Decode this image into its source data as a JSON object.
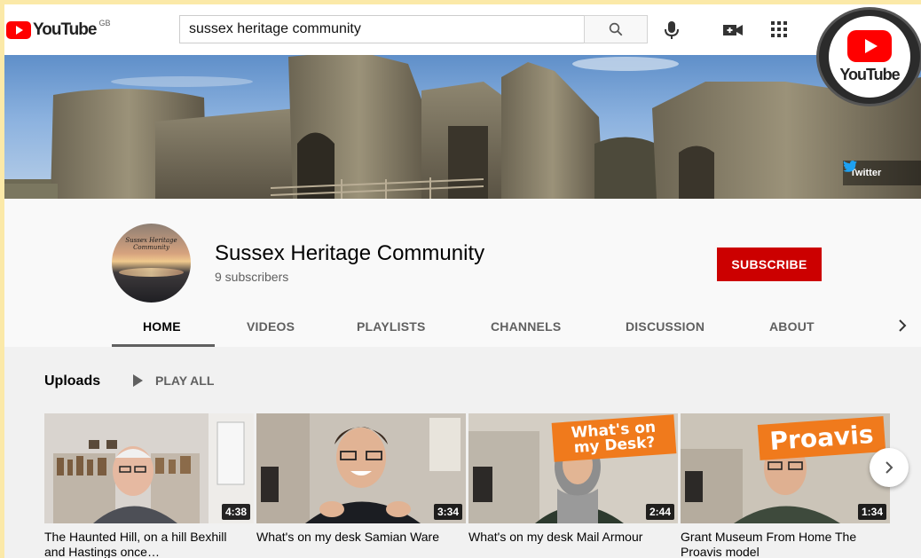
{
  "masthead": {
    "logo_text": "YouTube",
    "region": "GB",
    "search_value": "sussex heritage community",
    "icons": [
      "search-icon",
      "mic-icon",
      "create-video-icon",
      "apps-icon"
    ]
  },
  "overlay_logo": {
    "text": "YouTube"
  },
  "banner": {
    "link_label": "Twitter"
  },
  "channel": {
    "avatar_text": "Sussex Heritage Community",
    "title": "Sussex Heritage Community",
    "subscribers": "9 subscribers",
    "subscribe_label": "SUBSCRIBE"
  },
  "tabs": [
    {
      "label": "HOME",
      "active": true
    },
    {
      "label": "VIDEOS"
    },
    {
      "label": "PLAYLISTS"
    },
    {
      "label": "CHANNELS"
    },
    {
      "label": "DISCUSSION"
    },
    {
      "label": "ABOUT"
    }
  ],
  "uploads": {
    "heading": "Uploads",
    "play_all_label": "PLAY ALL",
    "videos": [
      {
        "title": "The Haunted Hill, on a hill Bexhill and Hastings once…",
        "duration": "4:38"
      },
      {
        "title": "What's on my desk Samian Ware",
        "duration": "3:34"
      },
      {
        "title": "What's on my desk Mail Armour",
        "duration": "2:44",
        "overlay": "What's on my Desk?"
      },
      {
        "title": "Grant Museum From Home The Proavis model",
        "duration": "1:34",
        "overlay": "Proavis"
      }
    ]
  },
  "colors": {
    "brand_red": "#ff0000",
    "subscribe_red": "#cc0000",
    "overlay_orange": "#f07a1c"
  }
}
